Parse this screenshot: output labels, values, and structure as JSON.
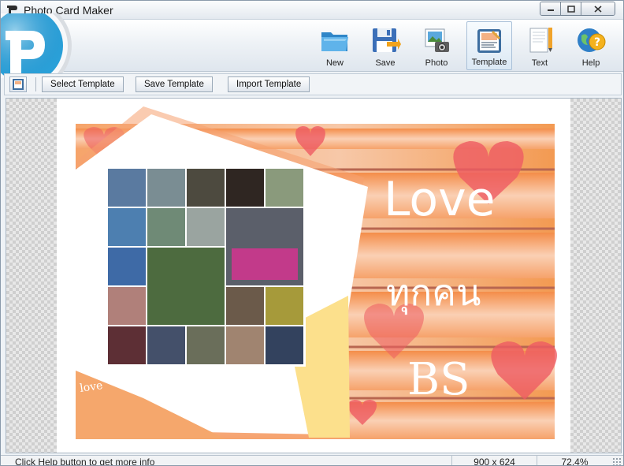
{
  "window": {
    "title": "Photo Card Maker"
  },
  "toolbar": {
    "new_label": "New",
    "save_label": "Save",
    "photo_label": "Photo",
    "template_label": "Template",
    "text_label": "Text",
    "help_label": "Help"
  },
  "subtoolbar": {
    "select_template_label": "Select Template",
    "save_template_label": "Save Template",
    "import_template_label": "Import Template"
  },
  "card": {
    "text_love": "Love",
    "text_thai": "ทุกคน",
    "text_bs": "BS",
    "stamp_text": "love"
  },
  "status": {
    "help_text": "Click Help button to get more info",
    "canvas_size": "900 x 624",
    "zoom": "72.4%"
  },
  "colors": {
    "accent": "#2aa0d8",
    "card_orange": "#f39a52",
    "card_pink": "#f7b7a5",
    "stripe": "#c66a55"
  }
}
